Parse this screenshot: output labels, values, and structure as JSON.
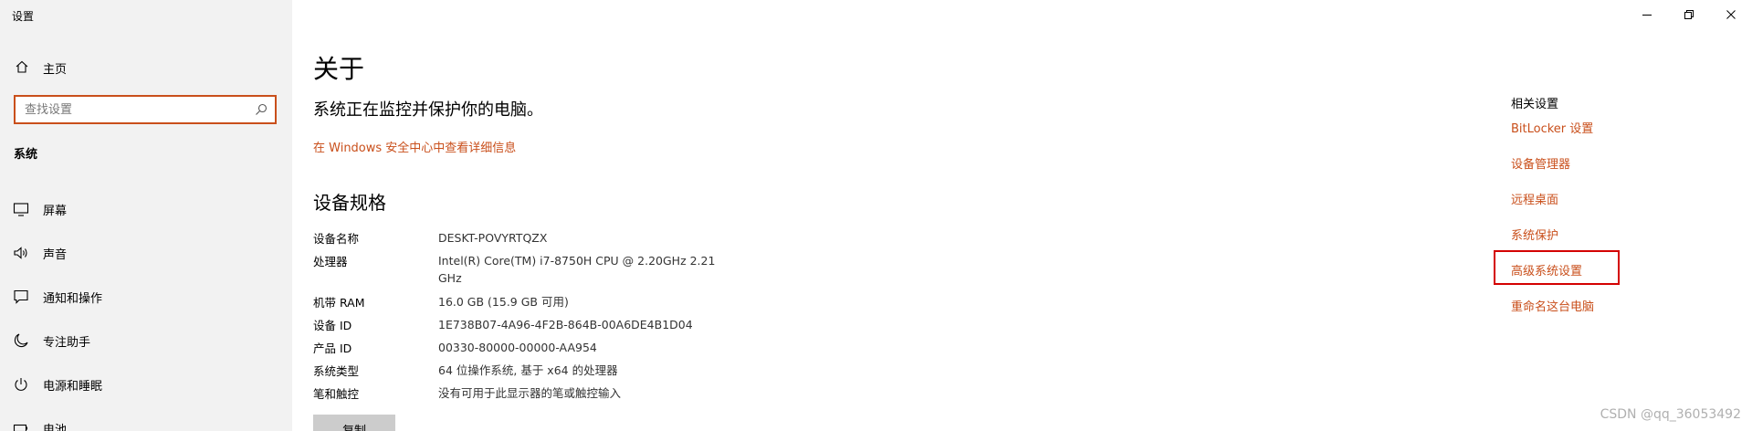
{
  "window": {
    "title": "设置"
  },
  "sidebar": {
    "home_label": "主页",
    "search_placeholder": "查找设置",
    "section_title": "系统",
    "items": [
      {
        "label": "屏幕",
        "icon": "monitor-icon"
      },
      {
        "label": "声音",
        "icon": "speaker-icon"
      },
      {
        "label": "通知和操作",
        "icon": "notification-icon"
      },
      {
        "label": "专注助手",
        "icon": "moon-icon"
      },
      {
        "label": "电源和睡眠",
        "icon": "power-icon"
      },
      {
        "label": "电池",
        "icon": "battery-icon"
      }
    ]
  },
  "main": {
    "title": "关于",
    "status": "系统正在监控并保护你的电脑。",
    "security_link": "在 Windows 安全中心中查看详细信息",
    "spec_title": "设备规格",
    "specs": [
      {
        "key": "设备名称",
        "value": "DESKT-POVYRTQZX"
      },
      {
        "key": "处理器",
        "value": "Intel(R) Core(TM) i7-8750H CPU @ 2.20GHz   2.21 GHz"
      },
      {
        "key": "机带 RAM",
        "value": "16.0 GB (15.9 GB 可用)"
      },
      {
        "key": "设备 ID",
        "value": "1E738B07-4A96-4F2B-864B-00A6DE4B1D04"
      },
      {
        "key": "产品 ID",
        "value": "00330-80000-00000-AA954"
      },
      {
        "key": "系统类型",
        "value": "64 位操作系统, 基于 x64 的处理器"
      },
      {
        "key": "笔和触控",
        "value": "没有可用于此显示器的笔或触控输入"
      }
    ],
    "copy_button": "复制"
  },
  "related": {
    "title": "相关设置",
    "links": [
      "BitLocker 设置",
      "设备管理器",
      "远程桌面",
      "系统保护",
      "高级系统设置",
      "重命名这台电脑"
    ]
  },
  "watermark": "CSDN @qq_36053492",
  "colors": {
    "accent": "#c94f1b",
    "highlight": "#d40000",
    "sidebar_bg": "#f2f2f2"
  }
}
